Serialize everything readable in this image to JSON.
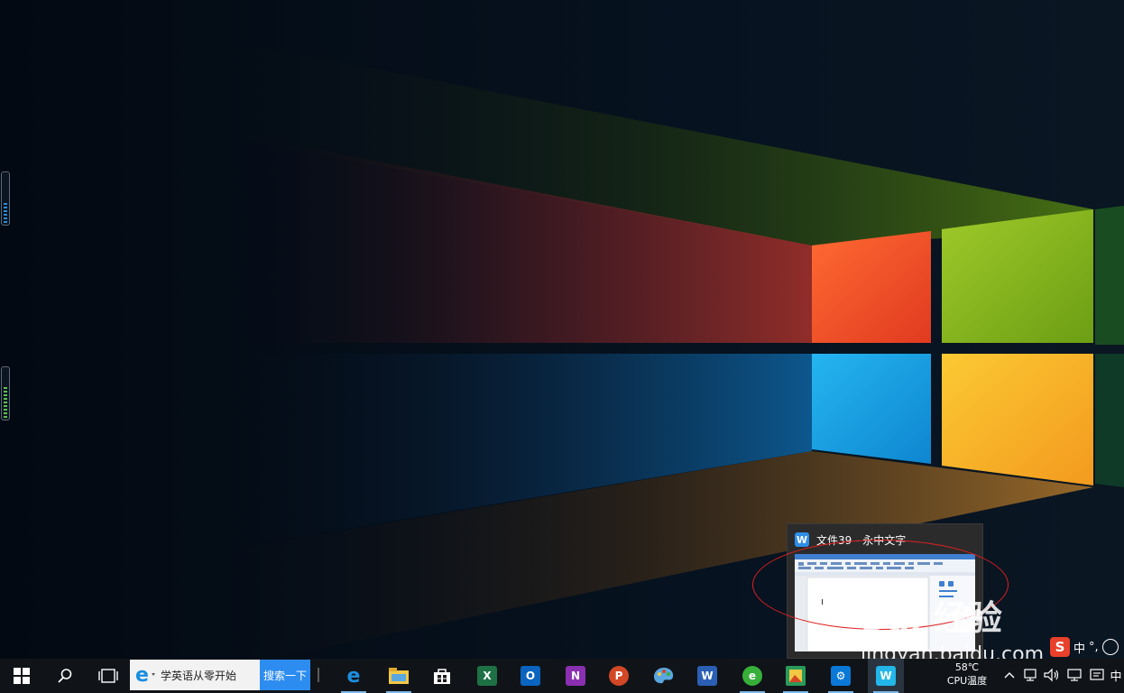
{
  "desktop": {
    "wallpaper_colors": {
      "red": "#f2522a",
      "green": "#8cbb1c",
      "blue": "#14a3e6",
      "yellow": "#f6b92b"
    }
  },
  "thumbnail_preview": {
    "title": "文件39 - 永中文字",
    "app_badge": "W"
  },
  "watermark": {
    "logo_text": "Bai  经验",
    "url": "jingyan.baidu.com"
  },
  "ime_toolbar": {
    "mode": "中",
    "punct": "°,",
    "brand_color": "#e8402a"
  },
  "taskbar": {
    "search": {
      "text": "学英语从零开始",
      "button_label": "搜索一下"
    },
    "apps": [
      {
        "name": "edge",
        "glyph": "e",
        "color": "#1e8fe0"
      },
      {
        "name": "file-explorer",
        "glyph": "",
        "color": "#f2c744"
      },
      {
        "name": "store",
        "glyph": "",
        "color": "#ffffff"
      },
      {
        "name": "excel",
        "glyph": "X",
        "color": "#1e7145"
      },
      {
        "name": "outlook",
        "glyph": "O",
        "color": "#0a64c0"
      },
      {
        "name": "onenote",
        "glyph": "N",
        "color": "#8a2fb0"
      },
      {
        "name": "powerpoint",
        "glyph": "P",
        "color": "#d24726"
      },
      {
        "name": "paint",
        "glyph": "",
        "color": "#5aa7e0"
      },
      {
        "name": "word",
        "glyph": "W",
        "color": "#2b5fb4"
      },
      {
        "name": "browser-360",
        "glyph": "e",
        "color": "#37b03a"
      },
      {
        "name": "photo-app",
        "glyph": "",
        "color": "#2a9a5a"
      },
      {
        "name": "settings",
        "glyph": "⚙",
        "color": "#0a78d6"
      },
      {
        "name": "yozo-office",
        "glyph": "W",
        "color": "#22b7e8"
      }
    ],
    "temperature": {
      "value": "58℃",
      "label": "CPU温度"
    },
    "tray": {
      "language": "中"
    }
  }
}
